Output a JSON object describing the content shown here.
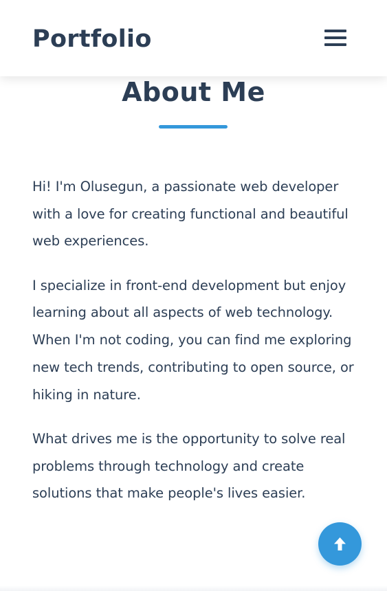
{
  "header": {
    "brand": "Portfolio",
    "menu_icon": "hamburger-menu-icon"
  },
  "about": {
    "title": "About Me",
    "accent_color": "#3498db",
    "paragraphs": [
      "Hi! I'm Olusegun, a passionate web developer with a love for creating functional and beautiful web experiences.",
      "I specialize in front-end development but enjoy learning about all aspects of web technology. When I'm not coding, you can find me exploring new tech trends, contributing to open source, or hiking in nature.",
      "What drives me is the opportunity to solve real problems through technology and create solutions that make people's lives easier."
    ]
  },
  "back_to_top": {
    "icon": "arrow-up-icon",
    "color": "#3498db"
  },
  "colors": {
    "text": "#2c3e55",
    "background": "#ffffff",
    "accent": "#3498db"
  }
}
